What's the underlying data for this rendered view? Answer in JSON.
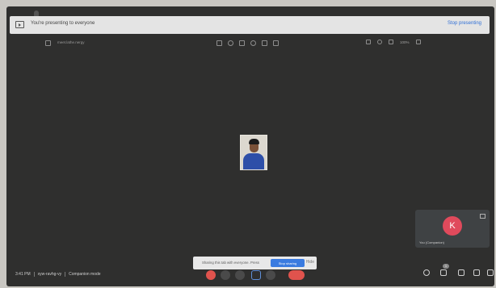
{
  "banner": {
    "message": "You're presenting to everyone",
    "stop_label": "Stop presenting"
  },
  "window_toolbar": {
    "tab_title": "meet.lathe.nergy",
    "zoom": "100%"
  },
  "self_view": {
    "avatar_letter": "K",
    "name": "You (Companion)"
  },
  "bottom_bar": {
    "time": "3:41 PM",
    "meeting_code": "xyw-ravhg-vy",
    "mode": "Companion mode"
  },
  "toast": {
    "message": "Sharing this tab with everyone. Press",
    "primary_label": "Stop sharing",
    "close_label": "Hide"
  },
  "right_tools": {
    "participants_count": "1"
  },
  "colors": {
    "stage_bg": "#2f2f2e",
    "accent_blue": "#3a7be0",
    "end_red": "#e0534d",
    "avatar_bg": "#e04a5c"
  }
}
